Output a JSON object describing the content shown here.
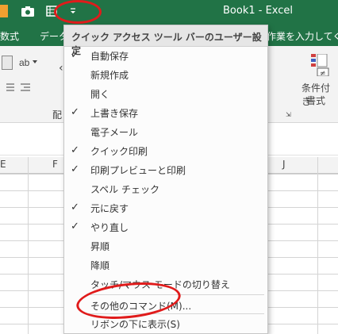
{
  "window": {
    "title": "Book1  -  Excel"
  },
  "ribbon": {
    "tabs": [
      "数式",
      "データ",
      "作業を入力してくだ"
    ],
    "group_label": "配",
    "conditional_format": {
      "line1": "条件付き",
      "line2": "書式"
    }
  },
  "grid": {
    "columns": [
      "E",
      "F",
      "J"
    ]
  },
  "menu": {
    "header": "クイック アクセス ツール バーのユーザー設定",
    "items": [
      {
        "label": "自動保存",
        "checked": true
      },
      {
        "label": "新規作成",
        "checked": false
      },
      {
        "label": "開く",
        "checked": false
      },
      {
        "label": "上書き保存",
        "checked": true
      },
      {
        "label": "電子メール",
        "checked": false
      },
      {
        "label": "クイック印刷",
        "checked": true
      },
      {
        "label": "印刷プレビューと印刷",
        "checked": true
      },
      {
        "label": "スペル チェック",
        "checked": false
      },
      {
        "label": "元に戻す",
        "checked": true
      },
      {
        "label": "やり直し",
        "checked": true
      },
      {
        "label": "昇順",
        "checked": false
      },
      {
        "label": "降順",
        "checked": false
      },
      {
        "label": "タッチ/マウス モードの切り替え",
        "checked": false
      }
    ],
    "more_commands": "その他のコマンド(M)...",
    "show_below": "リボンの下に表示(S)"
  },
  "checkmark": "✓"
}
